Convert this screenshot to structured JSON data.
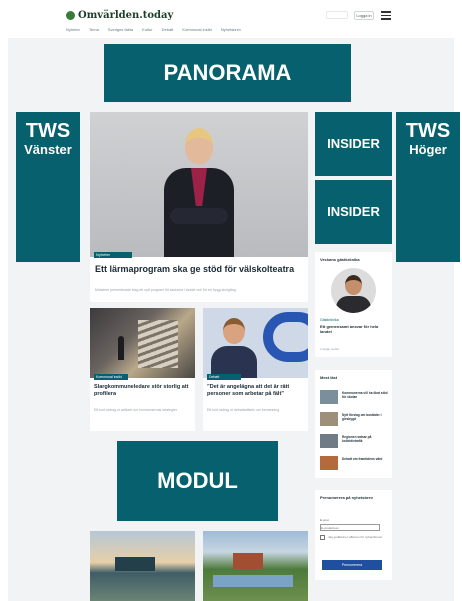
{
  "header": {
    "logo_text": "Omvärlden.today",
    "nav_items": [
      "Nyheter",
      "Tema",
      "Sveriges fakta",
      "Kultur",
      "Debatt",
      "Kommunal insikt",
      "Nyhetsbrev"
    ],
    "button_label": "Logga in"
  },
  "ads": {
    "panorama": "PANORAMA",
    "tws_left_big": "TWS",
    "tws_left_small": "Vänster",
    "tws_right_big": "TWS",
    "tws_right_small": "Höger",
    "insider1": "INSIDER",
    "insider2": "INSIDER",
    "modul": "MODUL"
  },
  "main_article": {
    "tag": "Nyheter",
    "title": "Ett lärmaprogram ska ge stöd för välskolteatra",
    "subtitle": "Ministern presenterade idag ett nytt program för skolorna i landet och för en trygg skolgång"
  },
  "articles": [
    {
      "tag": "Kommunal insikt",
      "title": "Slargkommuneledare stör storlig att profilera",
      "subtitle": "Ett kort utdrag ur artikeln om kommunernas strategier"
    },
    {
      "tag": "Debatt",
      "title": "”Det är angelägna att det är rätt personer som arbetar på fält”",
      "subtitle": "Ett kort utdrag ur debattartikeln om bemanning"
    }
  ],
  "sidebar": {
    "columnist_title": "Veckans gästkrönika",
    "columnist_kicker": "Gästkrönika",
    "columnist_text": "Ett gemensamt ansvar för hela landet",
    "columnist_meta": "2 dagar sedan",
    "news_title": "Mest läst",
    "news_items": [
      "Kommunerna vill ha ökat stöd för skolan",
      "Nytt förslag om bostäder i glesbygd",
      "Regionen satsar på kollektivtrafik",
      "Debatt om framtidens vård"
    ],
    "newsletter_title": "Prenumerera på nyhetsbrev",
    "newsletter_email_label": "E-post",
    "newsletter_email_placeholder": "E-postadress",
    "newsletter_check_text": "Jag godkänner villkoren för nyhetsbrevet",
    "newsletter_button": "Prenumerera"
  }
}
